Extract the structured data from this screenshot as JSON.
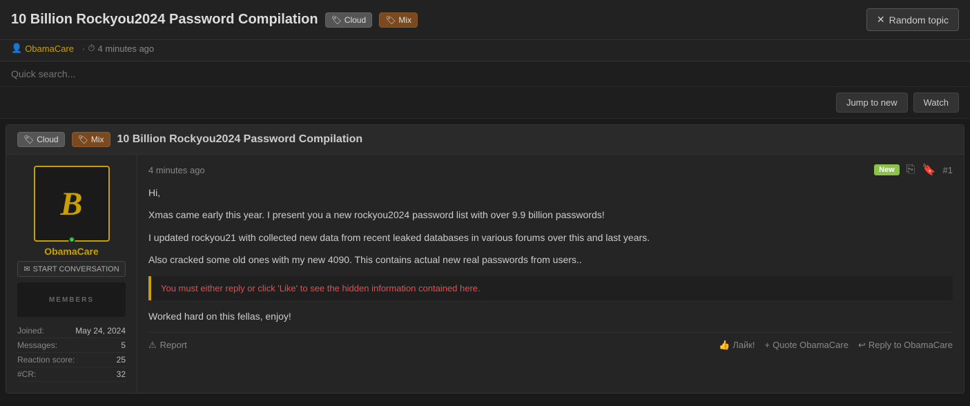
{
  "header": {
    "title": "10 Billion Rockyou2024 Password Compilation",
    "tags": [
      {
        "label": "Cloud",
        "type": "cloud"
      },
      {
        "label": "Mix",
        "type": "mix"
      }
    ],
    "random_topic_btn": "Random topic"
  },
  "meta": {
    "author": "ObamaCare",
    "time_ago": "4 minutes ago"
  },
  "search": {
    "placeholder": "Quick search..."
  },
  "toolbar": {
    "jump_to_new": "Jump to new",
    "watch": "Watch"
  },
  "thread": {
    "tags": [
      {
        "label": "Cloud",
        "type": "cloud"
      },
      {
        "label": "Mix",
        "type": "mix"
      }
    ],
    "title": "10 Billion Rockyou2024 Password Compilation"
  },
  "post": {
    "time_ago": "4 minutes ago",
    "post_number": "#1",
    "new_badge": "New",
    "body_lines": [
      "Hi,",
      "Xmas came early this year. I present you a new rockyou2024 password list with over 9.9 billion passwords!",
      "I updated rockyou21 with collected new data from recent leaked databases in various forums over this and last years.",
      "Also cracked some old ones with my new 4090. This contains actual new real passwords from users..",
      "Worked hard on this fellas, enjoy!"
    ],
    "hidden_notice": "You must either reply or click 'Like' to see the hidden information contained here.",
    "report_label": "Report",
    "like_label": "Лайк!",
    "quote_label": "Quote ObamaCare",
    "reply_label": "Reply to ObamaCare"
  },
  "user": {
    "username": "ObamaCare",
    "avatar_letter": "B",
    "start_conversation": "START CONVERSATION",
    "banner_text": "MEMBERS",
    "stats": [
      {
        "label": "Joined:",
        "value": "May 24, 2024"
      },
      {
        "label": "Messages:",
        "value": "5"
      },
      {
        "label": "Reaction score:",
        "value": "25"
      },
      {
        "label": "#CR:",
        "value": "32"
      }
    ]
  },
  "icons": {
    "random": "✕",
    "user": "👤",
    "clock": "⏰",
    "share": "⎘",
    "bookmark": "🔖",
    "thumbsup": "👍",
    "quote": "+",
    "reply": "↩",
    "envelope": "✉",
    "warning": "⚠",
    "tag": "🏷"
  }
}
